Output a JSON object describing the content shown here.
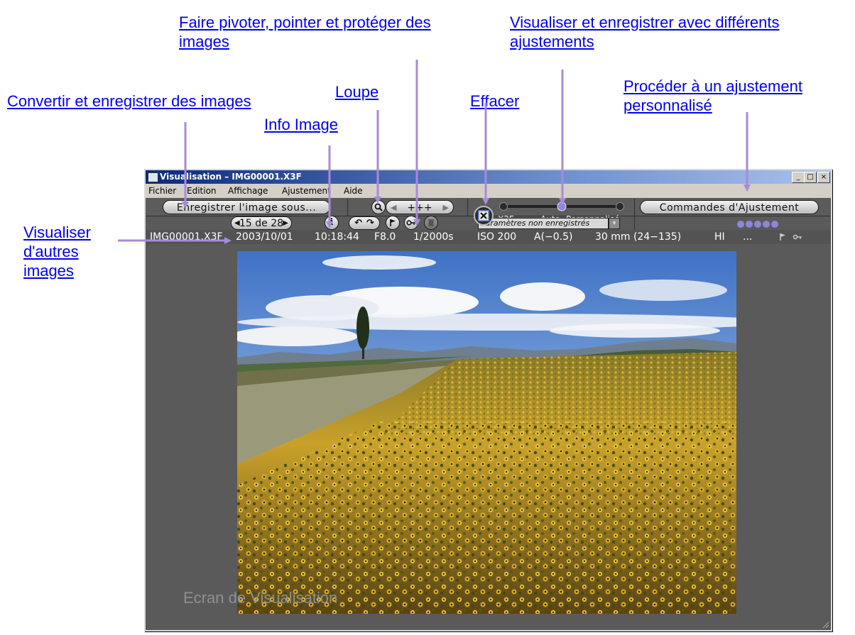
{
  "callouts": {
    "rotate_flag_protect": "Faire pivoter, pointer et protéger des images",
    "view_save_adjust": "Visualiser et enregistrer avec différents ajustements",
    "loupe": "Loupe",
    "convert_save": "Convertir et enregistrer des images",
    "info_image": "Info Image",
    "erase": "Effacer",
    "custom_adjust": "Procéder à un ajustement personnalisé",
    "other_images": "Visualiser d'autres images"
  },
  "window": {
    "title": "Visualisation – IMG00001.X3F",
    "controls": [
      "_",
      "□",
      "×"
    ]
  },
  "menu": [
    "Fichier",
    "Edition",
    "Affichage",
    "Ajustement",
    "Aide"
  ],
  "toolbar": {
    "save_as": "Enregistrer l'image sous...",
    "zoom_level": "+++",
    "navigation": "15 de 28",
    "slider_labels": [
      "X3F",
      "Auto",
      "Personnalisé"
    ],
    "slider_selected": "Auto",
    "adjust_controls": "Commandes d'Ajustement",
    "settings_status": "Paramètres non enregistrés",
    "preset_dots": 5
  },
  "info_bar": {
    "filename": "IMG00001.X3F",
    "date": "2003/10/01",
    "time": "10:18:44",
    "aperture": "F8.0",
    "shutter": "1/2000s",
    "iso": "ISO 200",
    "exposure": "A(−0.5)",
    "lens": "30 mm (24−135)",
    "quality": "HI",
    "more": "..."
  },
  "caption": "Ecran de Visualisation",
  "colors": {
    "link": "#0000ee",
    "arrow": "#a78bd8",
    "window_bg": "#5a5a5a"
  }
}
